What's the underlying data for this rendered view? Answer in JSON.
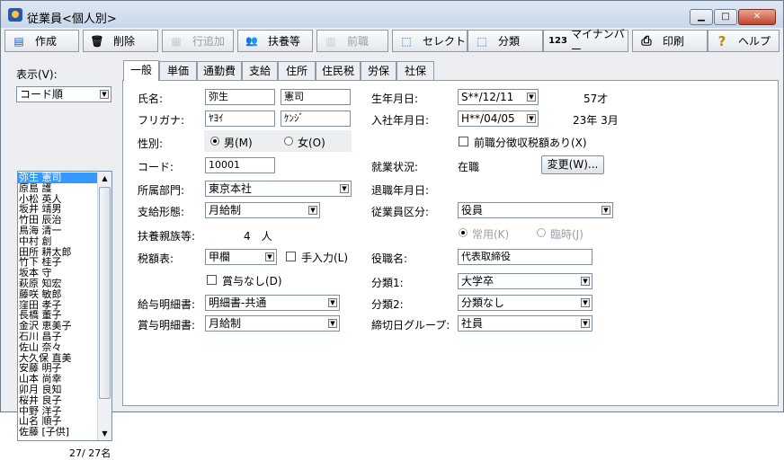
{
  "window": {
    "title": "従業員<個人別>",
    "min": "▁",
    "max": "□",
    "close": "✕"
  },
  "toolbar": [
    {
      "label": "作成",
      "icon": "create-icon",
      "glyph": "▤"
    },
    {
      "label": "削除",
      "icon": "trash-icon",
      "glyph": "🗑"
    },
    {
      "label": "行追加",
      "icon": "add-row-icon",
      "glyph": "▦",
      "disabled": true
    },
    {
      "label": "扶養等",
      "icon": "family-icon",
      "glyph": "👥"
    },
    {
      "label": "前職",
      "icon": "previous-job-icon",
      "glyph": "▥",
      "disabled": true
    },
    {
      "label": "セレクト",
      "icon": "select-icon",
      "glyph": "⬚"
    },
    {
      "label": "分類",
      "icon": "category-icon",
      "glyph": "⬚"
    },
    {
      "label": "マイナンバー",
      "icon": "my-number-icon",
      "glyph": "123"
    },
    {
      "label": "印刷",
      "icon": "printer-icon",
      "glyph": "⎙"
    },
    {
      "label": "ヘルプ",
      "icon": "help-icon",
      "glyph": "?"
    }
  ],
  "left": {
    "display_label": "表示(V):",
    "sort_value": "コード順",
    "employees": [
      "弥生 憲司",
      "原島 護",
      "小松 英人",
      "坂井 靖男",
      "竹田 辰治",
      "鳥海 清一",
      "中村 創",
      "田所 耕太郎",
      "竹下 桂子",
      "坂本 守",
      "萩原 知宏",
      "藤咲 敏郎",
      "窪田 孝子",
      "長橋 董子",
      "金沢 恵美子",
      "石川 昌子",
      "佐山 奈々",
      "大久保 直美",
      "安藤 明子",
      "山本 尚幸",
      "卯月 良知",
      "桜井 良子",
      "中野 洋子",
      "山名 順子",
      "佐藤 [子供]"
    ],
    "count": "27/ 27名"
  },
  "tabs": [
    "一般",
    "単価",
    "通勤費",
    "支給",
    "住所",
    "住民税",
    "労保",
    "社保"
  ],
  "form": {
    "name_label": "氏名:",
    "last_name": "弥生",
    "first_name": "憲司",
    "kana_label": "フリガナ:",
    "last_kana": "ﾔﾖｲ",
    "first_kana": "ｹﾝｼﾞ",
    "gender_label": "性別:",
    "male": "男(M)",
    "female": "女(O)",
    "code_label": "コード:",
    "code": "10001",
    "dept_label": "所属部門:",
    "dept": "東京本社",
    "pay_type_label": "支給形態:",
    "pay_type": "月給制",
    "dependents_label": "扶養親族等:",
    "dependents_value": "4　人",
    "tax_table_label": "税額表:",
    "tax_table": "甲欄",
    "manual_input": "手入力(L)",
    "no_bonus": "賞与なし(D)",
    "payslip_label": "給与明細書:",
    "payslip": "明細書-共通",
    "bonus_slip_label": "賞与明細書:",
    "bonus_slip": "月給制",
    "birth_label": "生年月日:",
    "birth": "S**/12/11",
    "age": "57才",
    "hire_label": "入社年月日:",
    "hire": "H**/04/05",
    "tenure": "23年 3月",
    "prev_tax": "前職分徴収税額あり(X)",
    "status_label": "就業状況:",
    "status": "在職",
    "change_btn": "変更(W)...",
    "retire_label": "退職年月日:",
    "emp_class_label": "従業員区分:",
    "emp_class": "役員",
    "regular": "常用(K)",
    "temporary": "臨時(J)",
    "position_label": "役職名:",
    "position": "代表取締役",
    "class1_label": "分類1:",
    "class1": "大学卒",
    "class2_label": "分類2:",
    "class2": "分類なし",
    "group_label": "締切日グループ:",
    "group": "社員"
  }
}
